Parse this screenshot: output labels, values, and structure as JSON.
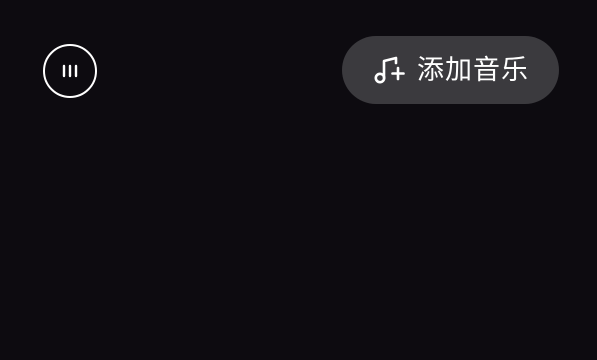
{
  "topbar": {
    "menu_icon": "ellipsis-circle-icon",
    "add_music": {
      "label": "添加音乐",
      "icon": "music-note-plus-icon"
    }
  },
  "colors": {
    "background": "#0d0b10",
    "pill_background": "#3b3a3e",
    "foreground": "#ffffff"
  }
}
